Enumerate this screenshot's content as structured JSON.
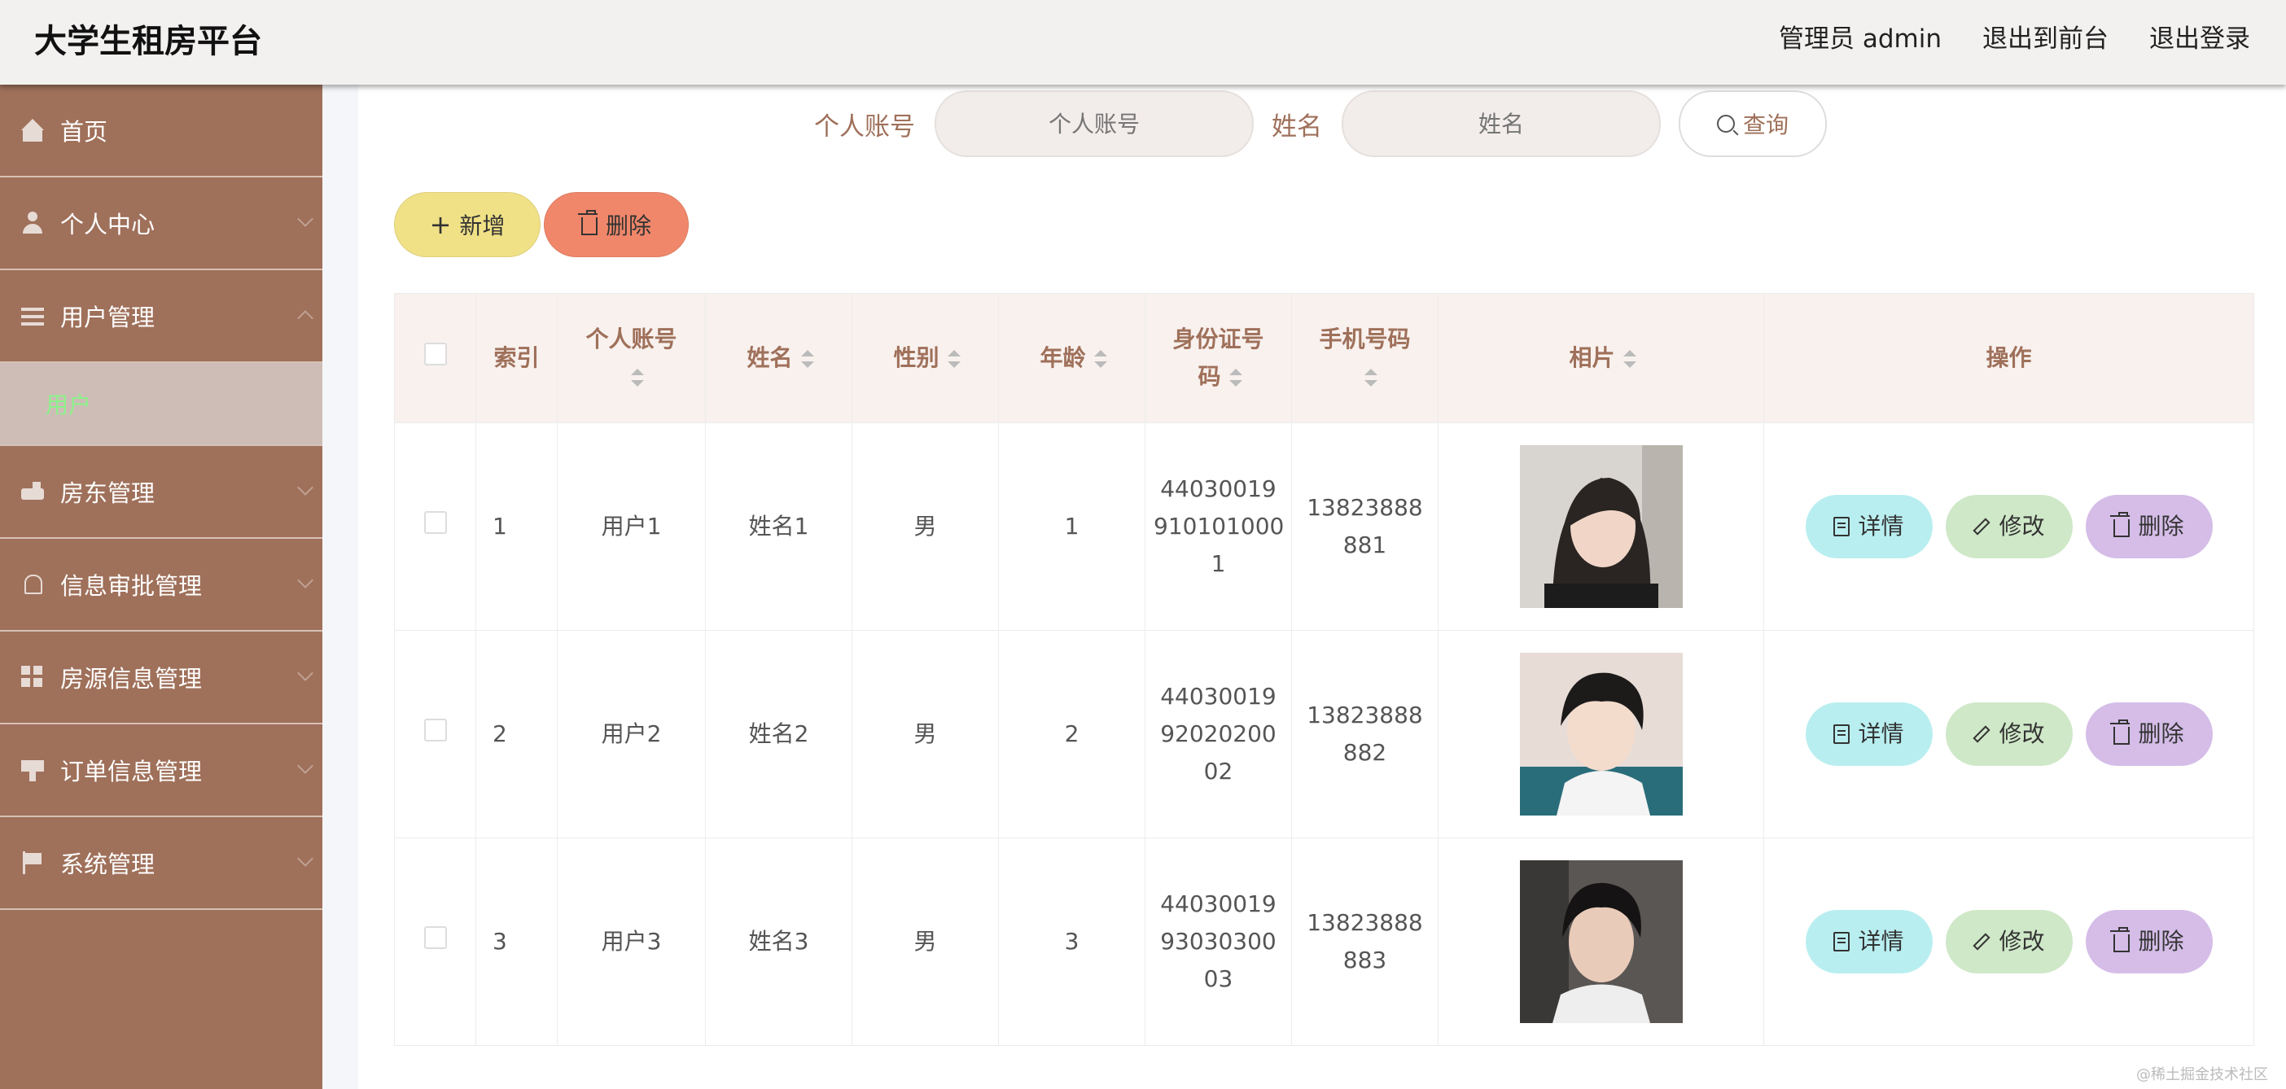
{
  "header": {
    "brand": "大学生租房平台",
    "admin": "管理员 admin",
    "to_front": "退出到前台",
    "logout": "退出登录"
  },
  "sidebar": {
    "items": [
      {
        "label": "首页",
        "icon": "home-icon"
      },
      {
        "label": "个人中心",
        "icon": "user-icon"
      },
      {
        "label": "用户管理",
        "icon": "list-icon"
      },
      {
        "label": "房东管理",
        "icon": "car-icon"
      },
      {
        "label": "信息审批管理",
        "icon": "bell-icon"
      },
      {
        "label": "房源信息管理",
        "icon": "grid-icon"
      },
      {
        "label": "订单信息管理",
        "icon": "cup-icon"
      },
      {
        "label": "系统管理",
        "icon": "flag-icon"
      }
    ],
    "sub_active": "用户"
  },
  "search": {
    "account_label": "个人账号",
    "account_placeholder": "个人账号",
    "name_label": "姓名",
    "name_placeholder": "姓名",
    "query": "查询"
  },
  "actions": {
    "add": "新增",
    "delete": "删除"
  },
  "table": {
    "headers": {
      "index": "索引",
      "account": "个人账号",
      "name": "姓名",
      "gender": "性别",
      "age": "年龄",
      "id_line1": "身份证号",
      "id_line2": "码",
      "phone": "手机号码",
      "photo": "相片",
      "ops": "操作"
    },
    "rows": [
      {
        "index": "1",
        "account": "用户1",
        "name": "姓名1",
        "gender": "男",
        "age": "1",
        "id_a": "44030019",
        "id_b": "910101000",
        "id_c": "1",
        "phone_a": "13823888",
        "phone_b": "881"
      },
      {
        "index": "2",
        "account": "用户2",
        "name": "姓名2",
        "gender": "男",
        "age": "2",
        "id_a": "44030019",
        "id_b": "92020200",
        "id_c": "02",
        "phone_a": "13823888",
        "phone_b": "882"
      },
      {
        "index": "3",
        "account": "用户3",
        "name": "姓名3",
        "gender": "男",
        "age": "3",
        "id_a": "44030019",
        "id_b": "93030300",
        "id_c": "03",
        "phone_a": "13823888",
        "phone_b": "883"
      }
    ],
    "ops": {
      "detail": "详情",
      "edit": "修改",
      "delete": "删除"
    }
  },
  "watermark": "@稀土掘金技术社区"
}
